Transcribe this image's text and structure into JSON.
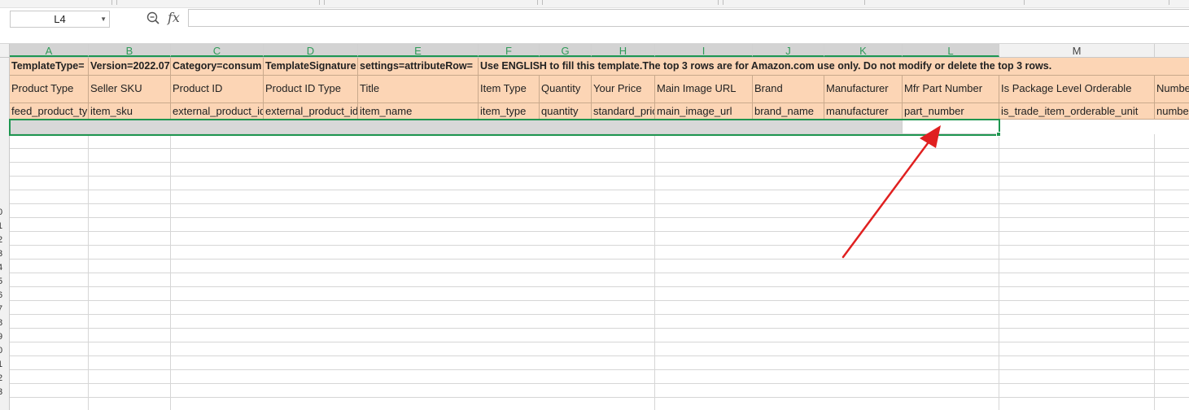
{
  "name_box": "L4",
  "formula_label": "fx",
  "formula_value": "",
  "columns": [
    "A",
    "B",
    "C",
    "D",
    "E",
    "F",
    "G",
    "H",
    "I",
    "J",
    "K",
    "L",
    "M"
  ],
  "row_numbers": [
    "0",
    "1",
    "2",
    "3",
    "4",
    "5",
    "6",
    "7",
    "8",
    "9",
    "0",
    "1",
    "2",
    "3"
  ],
  "row1": {
    "a": "TemplateType=",
    "b": "Version=2022.07",
    "c": "Category=consum",
    "d": "TemplateSignature",
    "e": "settings=attributeRow=",
    "f": "Use ENGLISH to fill this template.The top 3 rows are for Amazon.com use only. Do not modify or delete the top 3 rows."
  },
  "row2": [
    "Product Type",
    "Seller SKU",
    "Product ID",
    "Product ID Type",
    "Title",
    "Item Type",
    "Quantity",
    "Your Price",
    "Main Image URL",
    "Brand",
    "Manufacturer",
    "Mfr Part Number",
    "Is Package Level Orderable",
    "Number"
  ],
  "row3": [
    "feed_product_type",
    "item_sku",
    "external_product_id",
    "external_product_id_type",
    "item_name",
    "item_type",
    "quantity",
    "standard_price",
    "main_image_url",
    "brand_name",
    "manufacturer",
    "part_number",
    "is_trade_item_orderable_unit",
    "number"
  ],
  "colors": {
    "header_fill": "#fcd5b5",
    "selection": "#1e9650",
    "arrow": "#e02020"
  }
}
